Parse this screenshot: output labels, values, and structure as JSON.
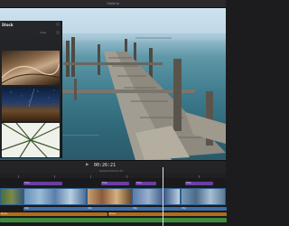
{
  "window": {
    "title": "Galleria"
  },
  "browser": {
    "title": "Stock",
    "filter_label": "Clips",
    "thumbnails": [
      {
        "name": "desert-dunes-thumbnail"
      },
      {
        "name": "night-sky-landscape-thumbnail"
      },
      {
        "name": "palm-fronds-thumbnail"
      }
    ]
  },
  "timeline": {
    "timecode": "00:26:21",
    "project": "Galleria  02:01:23",
    "connected_clips": [
      {
        "label": "Title",
        "color": "purple"
      },
      {
        "label": "Title",
        "color": "purple"
      },
      {
        "label": "Title",
        "color": "purple"
      },
      {
        "label": "Title",
        "color": "purple"
      }
    ],
    "video_clips": [
      {
        "label": "Clip"
      },
      {
        "label": "Clip"
      },
      {
        "label": "Clip"
      },
      {
        "label": "Clip"
      }
    ],
    "audio_clips": [
      {
        "label": "Music",
        "color": "orange"
      },
      {
        "label": "Music",
        "color": "orange"
      }
    ]
  },
  "colors": {
    "accent_purple": "#6a3fa0",
    "video_blue": "#3d6ea8",
    "audio_orange": "#b46b17",
    "audio_green": "#3f8a3f",
    "playhead": "#e0e0e0"
  }
}
